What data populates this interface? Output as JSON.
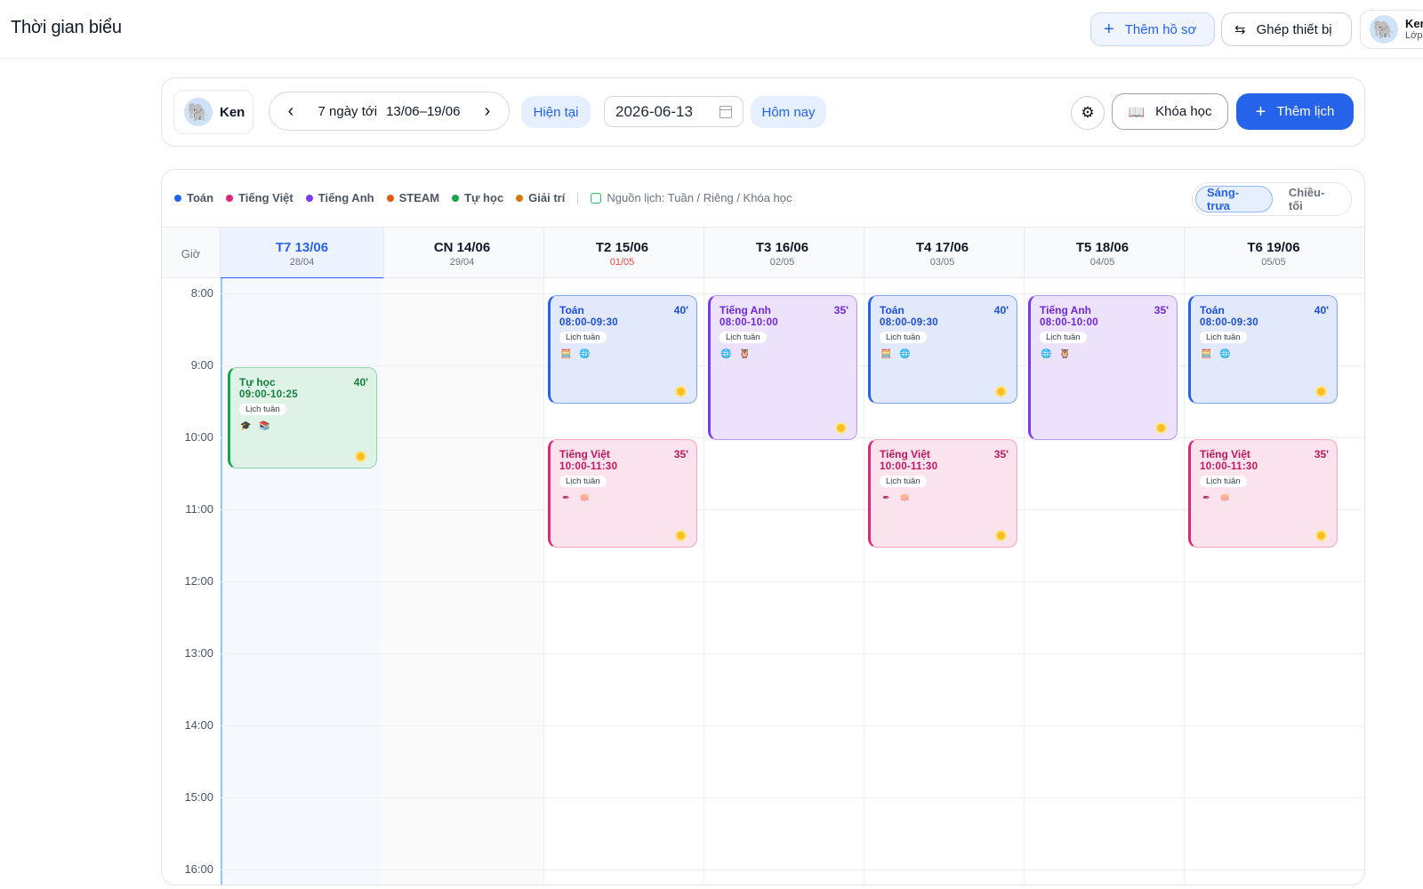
{
  "header": {
    "title": "Thời gian biểu",
    "add_profile": "Thêm hồ sơ",
    "pair_device": "Ghép thiết bị",
    "user_name": "Ken",
    "user_class": "Lớp"
  },
  "toolbar": {
    "kid_name": "Ken",
    "range_label": "7 ngày tới",
    "range_dates": "13/06–19/06",
    "current": "Hiện tại",
    "date_value": "2026-06-13",
    "today": "Hôm nay",
    "courses": "Khóa học",
    "add_schedule": "Thêm lịch"
  },
  "legend": {
    "items": [
      {
        "label": "Toán",
        "color": "#2563eb"
      },
      {
        "label": "Tiếng Việt",
        "color": "#db2777"
      },
      {
        "label": "Tiếng Anh",
        "color": "#7c3aed"
      },
      {
        "label": "STEAM",
        "color": "#ea580c"
      },
      {
        "label": "Tự học",
        "color": "#16a34a"
      },
      {
        "label": "Giải trí",
        "color": "#d97706"
      }
    ],
    "source": "Nguồn lịch: Tuần / Riêng / Khóa học"
  },
  "view_toggle": {
    "morning": "Sáng-trưa",
    "evening": "Chiều-tối"
  },
  "grid": {
    "hour_header": "Giờ",
    "hours": [
      "8:00",
      "9:00",
      "10:00",
      "11:00",
      "12:00",
      "13:00",
      "14:00",
      "15:00",
      "16:00"
    ],
    "days": [
      {
        "name": "T7 13/06",
        "lunar": "28/04"
      },
      {
        "name": "CN 14/06",
        "lunar": "29/04"
      },
      {
        "name": "T2 15/06",
        "lunar": "01/05"
      },
      {
        "name": "T3 16/06",
        "lunar": "02/05"
      },
      {
        "name": "T4 17/06",
        "lunar": "03/05"
      },
      {
        "name": "T5 18/06",
        "lunar": "04/05"
      },
      {
        "name": "T6 19/06",
        "lunar": "05/05"
      }
    ]
  },
  "events": {
    "self_study": {
      "title": "Tự học",
      "duration": "40'",
      "time": "09:00-10:25",
      "tag": "Lịch tuần"
    },
    "math": {
      "title": "Toán",
      "duration": "40'",
      "time": "08:00-09:30",
      "tag": "Lịch tuần"
    },
    "english": {
      "title": "Tiếng Anh",
      "duration": "35'",
      "time": "08:00-10:00",
      "tag": "Lịch tuần"
    },
    "vietnamese": {
      "title": "Tiếng Việt",
      "duration": "35'",
      "time": "10:00-11:30",
      "tag": "Lịch tuần"
    }
  }
}
